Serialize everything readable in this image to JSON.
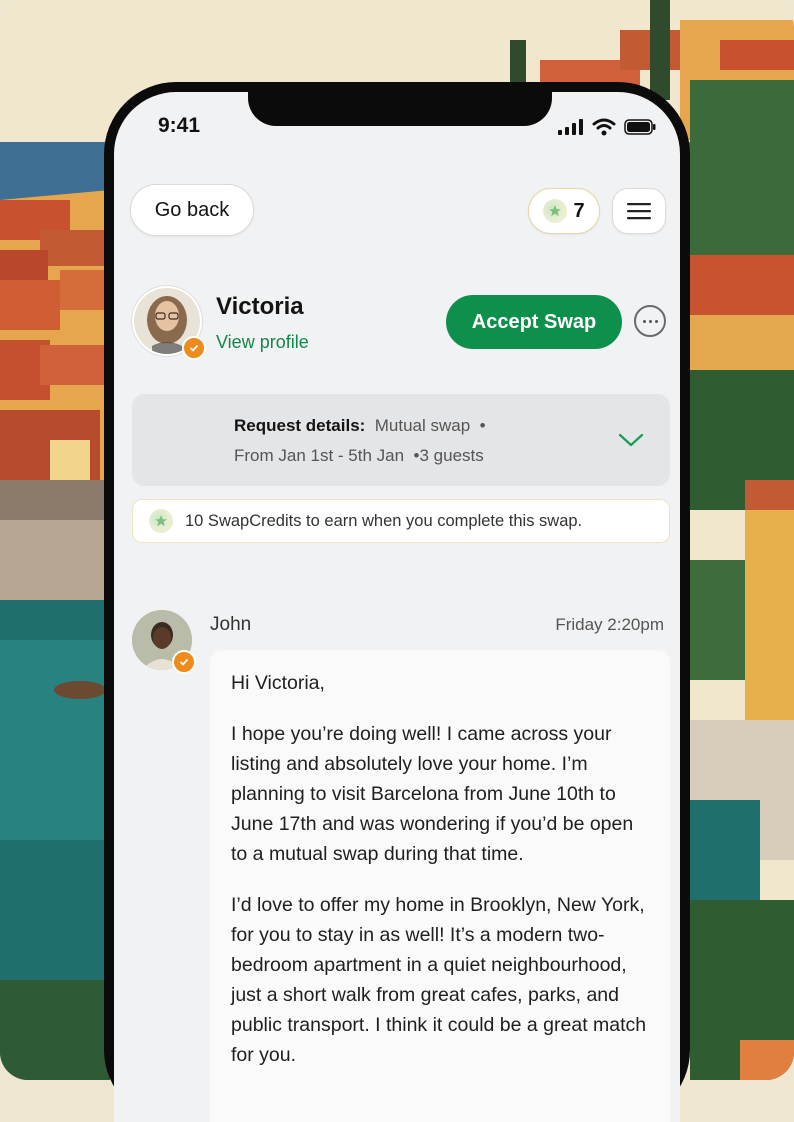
{
  "status_bar": {
    "time": "9:41"
  },
  "header": {
    "go_back_label": "Go back",
    "credit_count": "7"
  },
  "profile": {
    "name": "Victoria",
    "view_profile_label": "View profile",
    "accept_label": "Accept Swap"
  },
  "request": {
    "label": "Request details:",
    "type": "Mutual swap",
    "dates": "From Jan 1st - 5th Jan",
    "guests": "3 guests"
  },
  "earn_notice": "10 SwapCredits to earn when you complete this swap.",
  "message": {
    "sender": "John",
    "time": "Friday 2:20pm",
    "greeting": "Hi Victoria,",
    "paragraph1": "I hope you’re doing well! I came across your listing and absolutely love your home. I’m planning to visit Barcelona from June 10th to June 17th and was wondering if you’d be open to a mutual swap during that time.",
    "paragraph2": "I’d love to offer my home in Brooklyn, New York, for you to stay in as well! It’s a modern two-bedroom apartment in a quiet neighbourhood, just a short walk from great cafes, parks, and public transport. I think it could be a great match for you."
  },
  "colors": {
    "accent_green": "#0f8f4c",
    "badge_orange": "#ef8a1c"
  }
}
